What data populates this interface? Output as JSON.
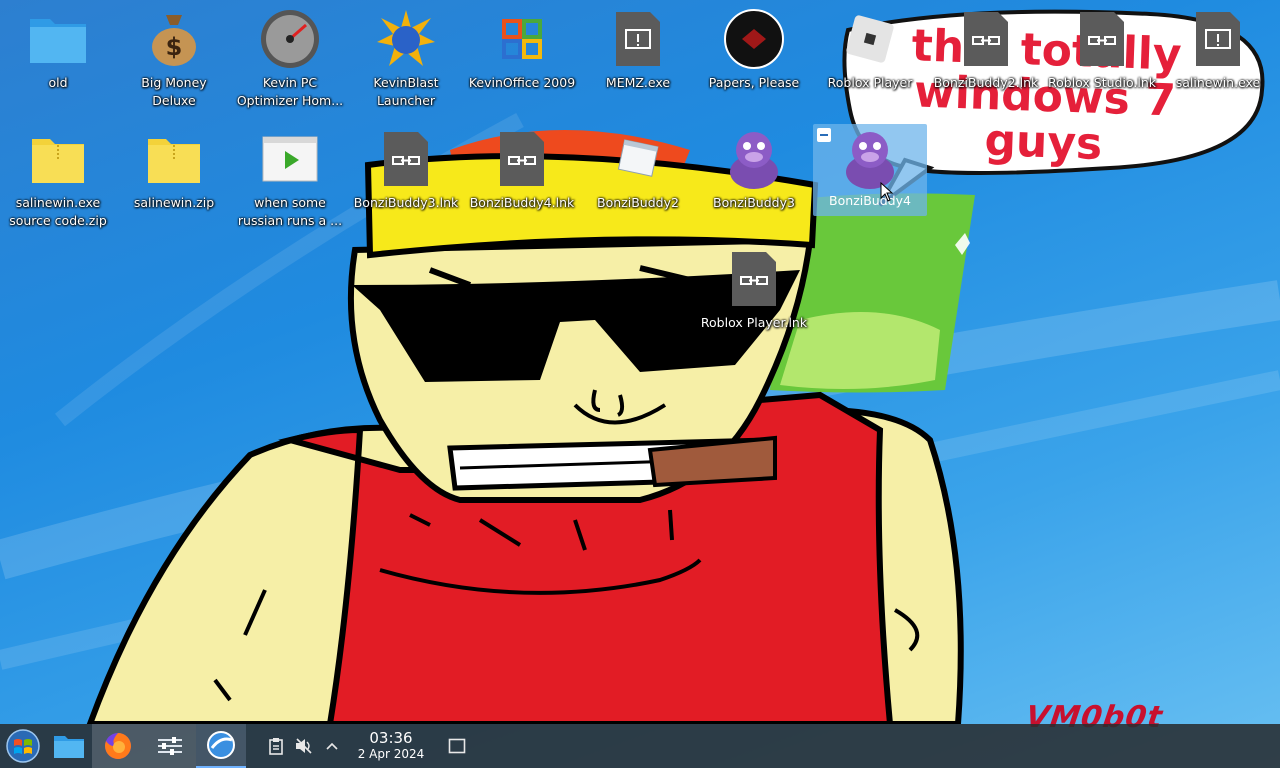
{
  "wallpaper": {
    "speech_text": "this totally windows 7 guys",
    "watermark": "VM0b0t"
  },
  "desktop_icons": [
    {
      "label": "old",
      "icon": "folder-icon"
    },
    {
      "label": "Big Money Deluxe",
      "icon": "money-bag-icon"
    },
    {
      "label": "Kevin PC Optimizer Hom...",
      "icon": "speedometer-icon"
    },
    {
      "label": "KevinBlast Launcher",
      "icon": "globe-burst-icon"
    },
    {
      "label": "KevinOffice 2009",
      "icon": "office-logo-icon"
    },
    {
      "label": "MEMZ.exe",
      "icon": "executable-icon"
    },
    {
      "label": "Papers, Please",
      "icon": "papers-please-icon"
    },
    {
      "label": "Roblox Player",
      "icon": "roblox-icon"
    },
    {
      "label": "BonziBuddy2.lnk",
      "icon": "shortcut-file-icon"
    },
    {
      "label": "Roblox Studio.lnk",
      "icon": "shortcut-file-icon"
    },
    {
      "label": "salinewin.exe",
      "icon": "executable-icon"
    },
    {
      "label": "salinewin.exe source code.zip",
      "icon": "zip-archive-icon"
    },
    {
      "label": "salinewin.zip",
      "icon": "zip-archive-icon"
    },
    {
      "label": "when some russian runs a ...",
      "icon": "video-file-icon"
    },
    {
      "label": "BonziBuddy3.lnk",
      "icon": "shortcut-file-icon"
    },
    {
      "label": "BonziBuddy4.lnk",
      "icon": "shortcut-file-icon"
    },
    {
      "label": "BonziBuddy2",
      "icon": "window-app-icon"
    },
    {
      "label": "BonziBuddy3",
      "icon": "bonzi-gorilla-icon"
    },
    {
      "label": "BonziBuddy4",
      "icon": "bonzi-gorilla-icon",
      "selected": true
    },
    {
      "label": "Roblox Player.lnk",
      "icon": "shortcut-file-icon"
    }
  ],
  "taskbar": {
    "apps": [
      {
        "name": "start-menu",
        "icon": "windows-orb-icon"
      },
      {
        "name": "file-manager",
        "icon": "folder-icon"
      },
      {
        "name": "firefox",
        "icon": "firefox-icon"
      },
      {
        "name": "system-settings",
        "icon": "sliders-icon"
      },
      {
        "name": "kevinblast",
        "icon": "globe-burst-icon"
      }
    ],
    "tray": [
      "clipboard-icon",
      "volume-muted-icon",
      "chevron-up-icon"
    ],
    "clock": {
      "time": "03:36",
      "date": "2 Apr 2024"
    },
    "show_desktop_icon": "show-desktop-icon"
  }
}
